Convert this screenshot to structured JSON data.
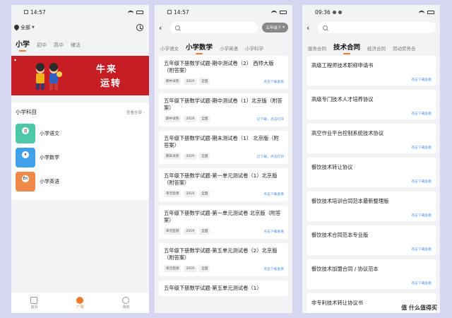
{
  "phone1": {
    "status_time": "14:57",
    "location": "全部",
    "tabs": [
      "小学",
      "初中",
      "高中",
      "律法"
    ],
    "banner": {
      "line1": "牛来",
      "line2": "运转"
    },
    "subjects_title": "小学科目",
    "see_all": "查看全部",
    "subjects": [
      {
        "label": "小学语文",
        "badge": "汉",
        "color": "#4cc8a8"
      },
      {
        "label": "小学数学",
        "badge": "π",
        "color": "#3fa2e8"
      },
      {
        "label": "小学英语",
        "badge": "En",
        "color": "#f08a4b"
      }
    ],
    "nav": [
      "首页",
      "广场",
      "我的"
    ]
  },
  "phone2": {
    "status_time": "14:57",
    "grade_button": "五年级下",
    "tabs": [
      "小学语文",
      "小学数学",
      "小学英语",
      "小学科学"
    ],
    "cards": [
      {
        "title": "五年级下册数学试题-期中测试卷（2） 西师大版（附答案）",
        "tags": [
          "期中试卷",
          "2019",
          "全国"
        ],
        "action": "点击下载查看"
      },
      {
        "title": "五年级下册数学试题-期中测试卷（1）北京版（附答案）",
        "tags": [
          "期中试卷",
          "2019",
          "全国"
        ],
        "action": "已下载，点击打开"
      },
      {
        "title": "五年级下册数学试题-期末测试卷（1） 北京版（附答案）",
        "tags": [
          "期末试卷",
          "2019",
          "全国"
        ],
        "action": "已下载，点击打开"
      },
      {
        "title": "五年级下册数学试题-第一单元测试卷（1）北京版（附答案）",
        "tags": [
          "单元检测",
          "2019",
          "全国"
        ],
        "action": "点击下载查看"
      },
      {
        "title": "五年级下册数学试题-第一单元测试卷 北京版（附答案）",
        "tags": [
          "单元检测",
          "2019",
          "全国"
        ],
        "action": "点击下载查看"
      },
      {
        "title": "五年级下册数学试题-第五单元测试卷（2）北京版（附答案）",
        "tags": [
          "单元检测",
          "2019",
          "全国"
        ],
        "action": "点击下载查看"
      },
      {
        "title": "五年级下册数学试题-第五单元测试卷（1）",
        "tags": [],
        "action": ""
      }
    ]
  },
  "phone3": {
    "status_time": "09:36",
    "tabs": [
      "服务合同",
      "技术合同",
      "经济合同",
      "劳动劳务合"
    ],
    "cards": [
      {
        "title": "高级工程师技术职称申请书",
        "action": "点击下载查看"
      },
      {
        "title": "高级专门技术人才培养协议",
        "action": "点击下载查看"
      },
      {
        "title": "高空作业平台控制系统技术协议",
        "action": "点击下载查看"
      },
      {
        "title": "餐饮技术转让协议",
        "action": "点击下载查看"
      },
      {
        "title": "餐饮技术培训合同范本最新整理版",
        "action": "点击下载查看"
      },
      {
        "title": "餐饮技术合同范本专业版",
        "action": "点击下载查看"
      },
      {
        "title": "餐饮技术加盟合同 / 协议范本",
        "action": "点击下载查看"
      },
      {
        "title": "非专利技术转让协议书",
        "action": ""
      }
    ],
    "watermark": "值 什么值得买"
  },
  "colors": {
    "accent": "#ee7b2f",
    "link": "#4a90e2",
    "banner": "#c71d24",
    "page_bg": "#d7d6f2"
  }
}
